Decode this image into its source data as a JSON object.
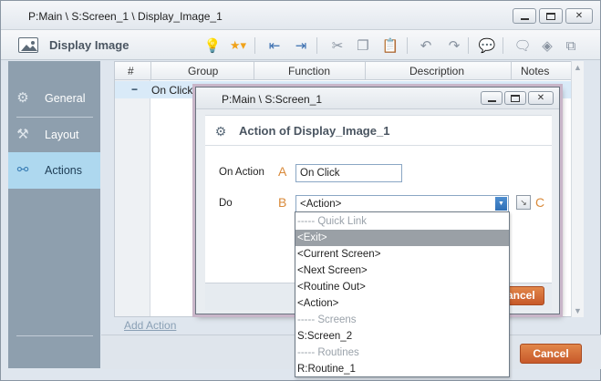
{
  "window": {
    "title": "P:Main \\ S:Screen_1 \\ Display_Image_1",
    "min_label": "",
    "max_label": "",
    "close_label": "✕"
  },
  "toolbar": {
    "title": "Display Image",
    "tools": [
      {
        "name": "tip-bulb-icon",
        "glyph": "💡"
      },
      {
        "name": "favorite-star-icon",
        "glyph": "★▾"
      },
      {
        "name": "outdent-icon",
        "glyph": "⇤"
      },
      {
        "name": "indent-icon",
        "glyph": "⇥"
      },
      {
        "name": "cut-icon",
        "glyph": "✂"
      },
      {
        "name": "copy-icon",
        "glyph": "❐"
      },
      {
        "name": "paste-icon",
        "glyph": "📋"
      },
      {
        "name": "undo-icon",
        "glyph": "↶"
      },
      {
        "name": "redo-icon",
        "glyph": "↷"
      },
      {
        "name": "comment-icon",
        "glyph": "💬"
      },
      {
        "name": "chat-bubble-icon",
        "glyph": "🗨"
      },
      {
        "name": "tag-icon",
        "glyph": "◈"
      },
      {
        "name": "edit-box-icon",
        "glyph": "⧉"
      }
    ]
  },
  "nav": {
    "items": [
      {
        "label": "General",
        "icon": "⚙",
        "active": false
      },
      {
        "label": "Layout",
        "icon": "⚒",
        "active": false
      },
      {
        "label": "Actions",
        "icon": "⚯",
        "active": true
      }
    ]
  },
  "grid": {
    "columns": [
      "#",
      "Group",
      "Function",
      "Description",
      "Notes"
    ],
    "rows": [
      {
        "marker": "−",
        "group": "On Click"
      }
    ],
    "add_action": "Add Action",
    "scroll_up": "▲",
    "scroll_down": "▼"
  },
  "footer": {
    "cancel_label": "Cancel"
  },
  "dialog": {
    "window_title": "P:Main \\ S:Screen_1",
    "header_title": "Action of Display_Image_1",
    "header_icon": "⚙",
    "on_action_label": "On Action",
    "on_action_letter": "A",
    "on_action_value": "On Click",
    "do_label": "Do",
    "do_letter": "B",
    "do_value": "<Action>",
    "do_arrow": "▼",
    "edit_letter": "C",
    "edit_glyph": "↘",
    "cancel_label": "Cancel",
    "close_label": "✕"
  },
  "dropdown": {
    "items": [
      {
        "label": "----- Quick Link",
        "type": "header"
      },
      {
        "label": "<Exit>",
        "type": "selected"
      },
      {
        "label": "<Current Screen>",
        "type": "option"
      },
      {
        "label": "<Next Screen>",
        "type": "option"
      },
      {
        "label": "<Routine Out>",
        "type": "option"
      },
      {
        "label": "<Action>",
        "type": "option"
      },
      {
        "label": "----- Screens",
        "type": "header"
      },
      {
        "label": "S:Screen_2",
        "type": "option"
      },
      {
        "label": "----- Routines",
        "type": "header"
      },
      {
        "label": "R:Routine_1",
        "type": "option"
      }
    ]
  }
}
